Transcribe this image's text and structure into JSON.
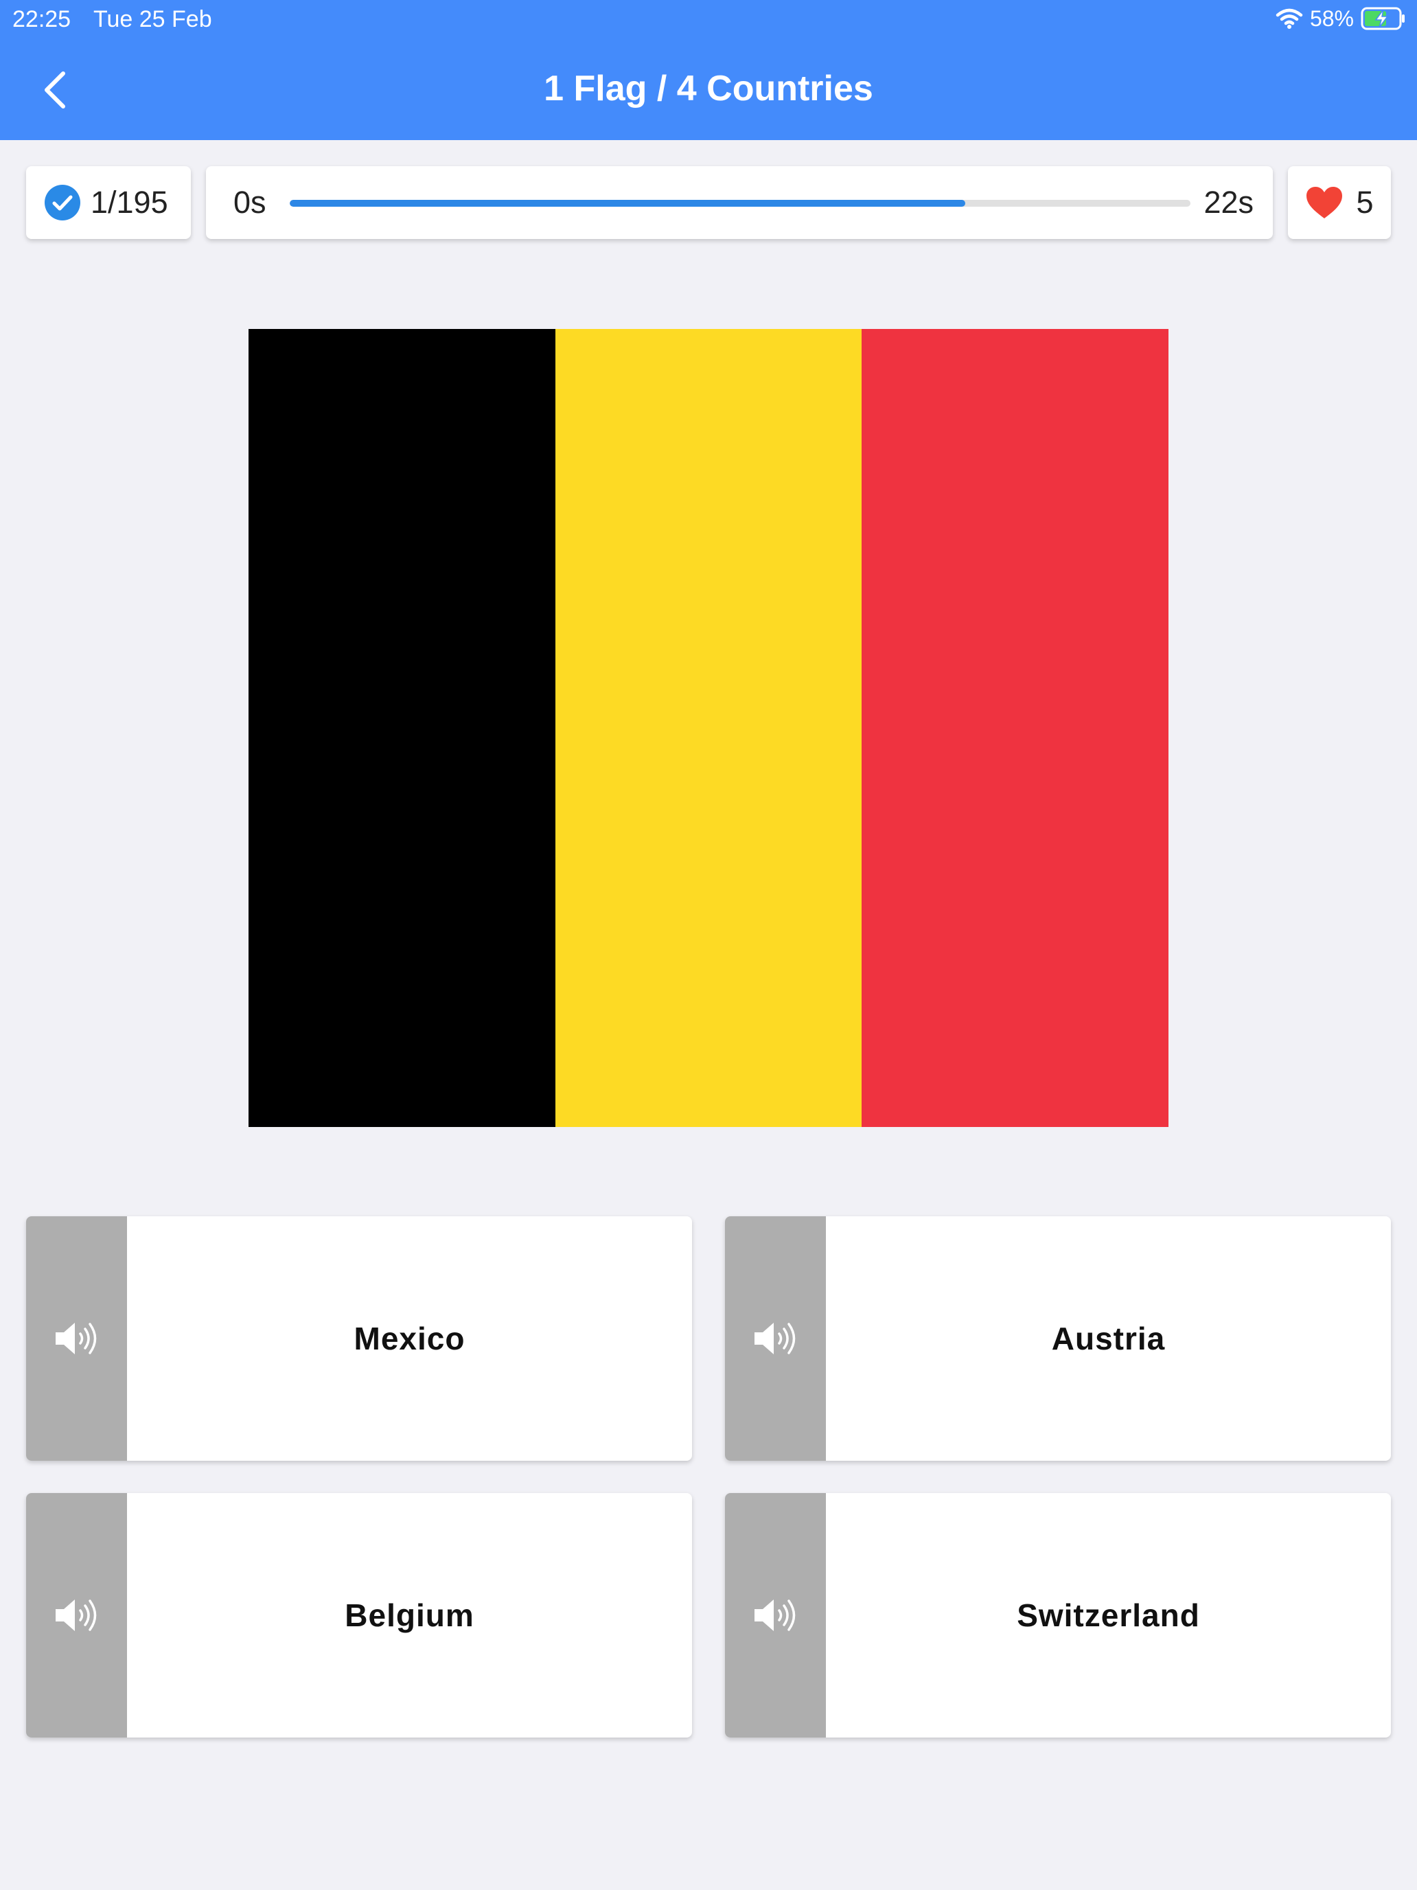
{
  "status_bar": {
    "time": "22:25",
    "date": "Tue 25 Feb",
    "battery": "58%"
  },
  "header": {
    "title": "1 Flag / 4 Countries",
    "back_icon": "chevron-left-icon"
  },
  "stats": {
    "progress": "1/195",
    "timer_start": "0s",
    "timer_end": "22s",
    "timer_fraction": 0.75,
    "lives": "5"
  },
  "flag": {
    "stripe_colors": [
      "#000000",
      "#fdda24",
      "#ef3340"
    ]
  },
  "answers": [
    {
      "label": "Mexico"
    },
    {
      "label": "Austria"
    },
    {
      "label": "Belgium"
    },
    {
      "label": "Switzerland"
    }
  ],
  "colors": {
    "header": "#448bfb",
    "background": "#f1f1f6",
    "timer_fill": "#2c87e6",
    "speaker_panel": "#aeaeae",
    "heart": "#f24336",
    "check": "#2a8ae6"
  }
}
